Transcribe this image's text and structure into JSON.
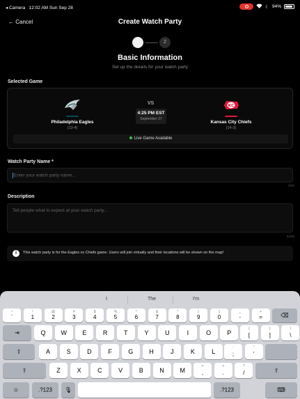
{
  "status_bar": {
    "back_app": "◂ Camera",
    "time_date": "12:02 AM   Sun Sep 28",
    "battery": "94%",
    "battery_level": 0.94
  },
  "header": {
    "cancel_label": "← Cancel",
    "title": "Create Watch Party"
  },
  "steps": {
    "current": 1,
    "second_label": "2"
  },
  "section": {
    "title": "Basic Information",
    "subtitle": "Set up the details for your watch party"
  },
  "selected_game": {
    "label": "Selected Game",
    "home": {
      "name": "Philadelphia Eagles",
      "record": "(13-4)",
      "color": "#004c54"
    },
    "vs": "VS",
    "time": "4:25 PM EST",
    "date": "September 27",
    "away": {
      "name": "Kansas City Chiefs",
      "record": "(14-3)",
      "color": "#e31837"
    },
    "live_label": "Live Game Available"
  },
  "name_field": {
    "label": "Watch Party Name *",
    "placeholder": "Enter your watch party name...",
    "counter": "0/50"
  },
  "description_field": {
    "label": "Description",
    "placeholder": "Tell people what to expect at your watch party...",
    "counter": "0/200"
  },
  "info": {
    "icon": "i",
    "text": "This watch party is for the Eagles vs Chiefs game. Users will join virtually and their locations will be shown on the map!"
  },
  "keyboard": {
    "suggestions": [
      "I",
      "The",
      "I'm"
    ],
    "row_numbers": [
      {
        "main": "`",
        "alt": "~"
      },
      {
        "main": "1",
        "alt": "!"
      },
      {
        "main": "2",
        "alt": "@"
      },
      {
        "main": "3",
        "alt": "#"
      },
      {
        "main": "4",
        "alt": "$"
      },
      {
        "main": "5",
        "alt": "%"
      },
      {
        "main": "6",
        "alt": "^"
      },
      {
        "main": "7",
        "alt": "&"
      },
      {
        "main": "8",
        "alt": "*"
      },
      {
        "main": "9",
        "alt": "("
      },
      {
        "main": "0",
        "alt": ")"
      },
      {
        "main": "-",
        "alt": "_"
      },
      {
        "main": "=",
        "alt": "+"
      }
    ],
    "delete_key": "⌫",
    "row_q": [
      "Q",
      "W",
      "E",
      "R",
      "T",
      "Y",
      "U",
      "I",
      "O",
      "P"
    ],
    "row_q_extra": [
      {
        "main": "[",
        "alt": "{"
      },
      {
        "main": "]",
        "alt": "}"
      },
      {
        "main": "\\",
        "alt": "|"
      }
    ],
    "tab_key": "⇥",
    "row_a": [
      "A",
      "S",
      "D",
      "F",
      "G",
      "H",
      "J",
      "K",
      "L"
    ],
    "row_a_extra": [
      {
        "main": ";",
        "alt": ":"
      },
      {
        "main": "'",
        "alt": "\""
      }
    ],
    "caps_key": "⇪",
    "return_key": "",
    "row_z": [
      "Z",
      "X",
      "C",
      "V",
      "B",
      "N",
      "M"
    ],
    "row_z_extra": [
      {
        "main": ",",
        "alt": "<"
      },
      {
        "main": ".",
        "alt": ">"
      },
      {
        "main": "/",
        "alt": "?"
      }
    ],
    "shift_key": "⇧",
    "emoji_key": "☺",
    "num_key": ".?123",
    "mic_key": "🎙",
    "space_label": "",
    "keyboard_hide_key": "⌨"
  }
}
